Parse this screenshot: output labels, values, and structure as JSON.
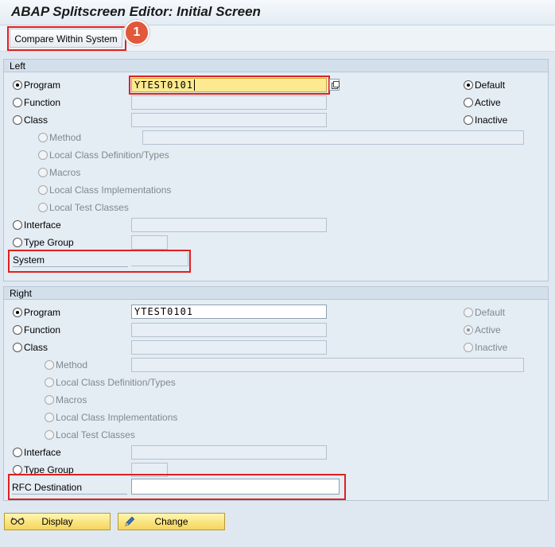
{
  "window": {
    "title": "ABAP Splitscreen Editor: Initial Screen"
  },
  "toolbar": {
    "compare_label": "Compare Within System",
    "step_marker": "1"
  },
  "left": {
    "heading": "Left",
    "program_label": "Program",
    "program_value": "YTEST0101",
    "function_label": "Function",
    "class_label": "Class",
    "method_label": "Method",
    "local_def_label": "Local Class Definition/Types",
    "macros_label": "Macros",
    "local_impl_label": "Local Class Implementations",
    "local_test_label": "Local Test Classes",
    "interface_label": "Interface",
    "type_group_label": "Type Group",
    "system_label": "System",
    "default_label": "Default",
    "active_label": "Active",
    "inactive_label": "Inactive"
  },
  "right": {
    "heading": "Right",
    "program_label": "Program",
    "program_value": "YTEST0101",
    "function_label": "Function",
    "class_label": "Class",
    "method_label": "Method",
    "local_def_label": "Local Class Definition/Types",
    "macros_label": "Macros",
    "local_impl_label": "Local Class Implementations",
    "local_test_label": "Local Test Classes",
    "interface_label": "Interface",
    "type_group_label": "Type Group",
    "rfc_label": "RFC Destination",
    "default_label": "Default",
    "active_label": "Active",
    "inactive_label": "Inactive"
  },
  "footer": {
    "display_label": "Display",
    "change_label": "Change"
  },
  "icons": {
    "display": "glasses-icon",
    "change": "pencil-icon",
    "value_help": "value-help-icon"
  },
  "colors": {
    "highlight": "#e02020",
    "focus_field": "#fde98f",
    "button": "#f5d45a",
    "marker": "#e2583a"
  }
}
